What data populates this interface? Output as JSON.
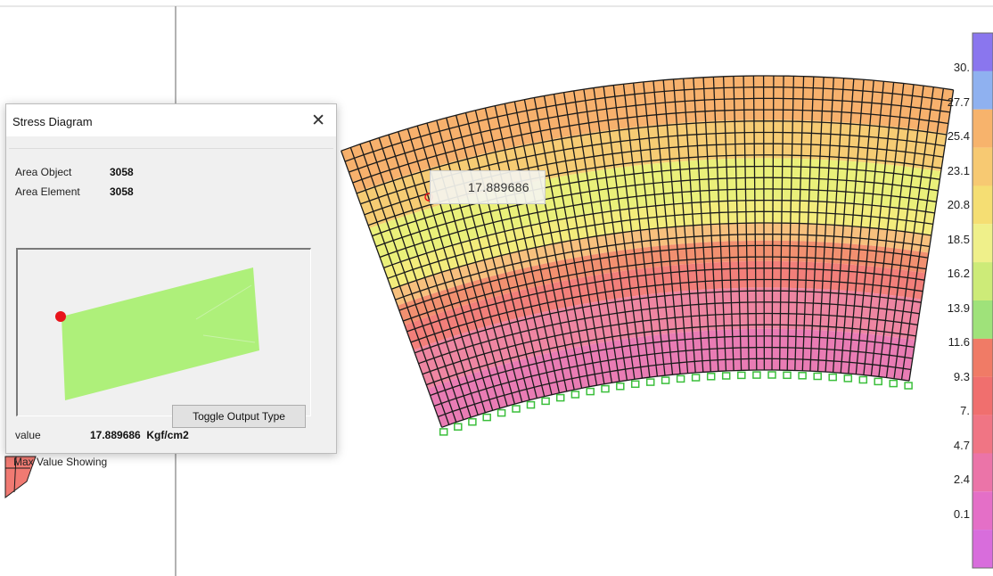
{
  "viewport": {
    "point_label": "17.889686",
    "legend_labels": [
      "30.",
      "27.7",
      "25.4",
      "23.1",
      "20.8",
      "18.5",
      "16.2",
      "13.9",
      "11.6",
      "9.3",
      "7.",
      "4.7",
      "2.4",
      "0.1"
    ],
    "legend_colors": [
      "#8a76ee",
      "#8fb1f0",
      "#f7b36c",
      "#f7c972",
      "#f5de73",
      "#eff08a",
      "#cdeb78",
      "#9fe27a",
      "#f07b66",
      "#f06f6e",
      "#f07584",
      "#eb74a8",
      "#e46fc7",
      "#d86ddc"
    ]
  },
  "dialog": {
    "title": "Stress Diagram",
    "close_glyph": "✕",
    "area_object_label": "Area Object",
    "area_object_value": "3058",
    "area_element_label": "Area Element",
    "area_element_value": "3058",
    "value_label": "value",
    "value_text": "17.889686  Kgf/cm2",
    "status_text": "Max Value Showing",
    "toggle_button_label": "Toggle Output Type",
    "element_color": "#aef07a"
  }
}
